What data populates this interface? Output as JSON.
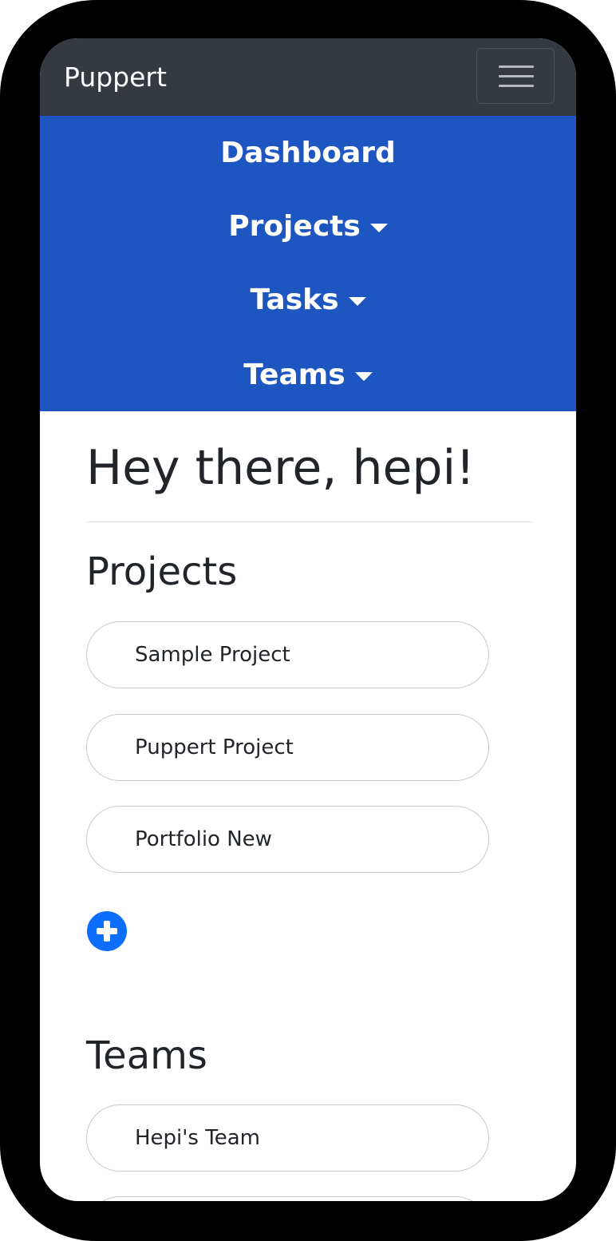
{
  "app": {
    "brand": "Puppert"
  },
  "nav": {
    "items": [
      {
        "label": "Dashboard",
        "dropdown": false
      },
      {
        "label": "Projects",
        "dropdown": true
      },
      {
        "label": "Tasks",
        "dropdown": true
      },
      {
        "label": "Teams",
        "dropdown": true
      }
    ]
  },
  "main": {
    "greeting": "Hey there, hepi!",
    "projects": {
      "title": "Projects",
      "items": [
        "Sample Project",
        "Puppert Project",
        "Portfolio New"
      ]
    },
    "teams": {
      "title": "Teams",
      "items": [
        "Hepi's Team"
      ]
    }
  },
  "colors": {
    "topbar": "#343a40",
    "nav_background": "#1e56c1",
    "add_button": "#0d6efd"
  },
  "icons": {
    "menu": "hamburger-icon",
    "dropdown": "caret-down-icon",
    "add": "plus-circle-icon"
  }
}
